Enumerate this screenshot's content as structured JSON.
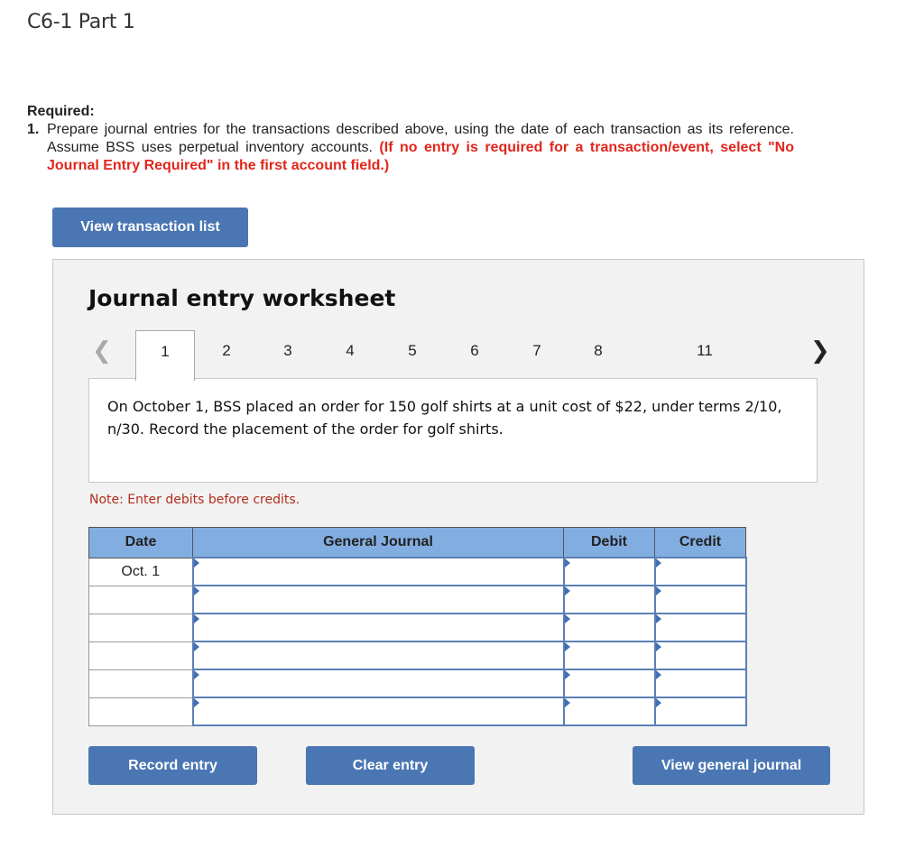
{
  "page": {
    "title": "C6-1 Part 1"
  },
  "required": {
    "label": "Required:",
    "item_number": "1.",
    "text": "Prepare journal entries for the transactions described above, using the date of each transaction as its reference. Assume BSS uses perpetual inventory accounts. ",
    "instruction": "(If no entry is required for a transaction/event, select \"No Journal Entry Required\" in the first account field.)"
  },
  "buttons": {
    "view_transaction_list": "View transaction list",
    "record_entry": "Record entry",
    "clear_entry": "Clear entry",
    "view_general_journal": "View general journal"
  },
  "worksheet": {
    "title": "Journal entry worksheet",
    "tabs": [
      {
        "label": "1",
        "active": true
      },
      {
        "label": "2",
        "active": false
      },
      {
        "label": "3",
        "active": false
      },
      {
        "label": "4",
        "active": false
      },
      {
        "label": "5",
        "active": false
      },
      {
        "label": "6",
        "active": false
      },
      {
        "label": "7",
        "active": false
      },
      {
        "label": "8",
        "active": false
      },
      {
        "label": "11",
        "active": false
      }
    ],
    "prev_icon": "chevron-left-icon",
    "next_icon": "chevron-right-icon",
    "question": "On October 1, BSS placed an order for 150 golf shirts at a unit cost of $22, under terms 2/10, n/30. Record the placement of the order for golf shirts.",
    "note": "Note: Enter debits before credits."
  },
  "journal": {
    "headers": {
      "date": "Date",
      "general_journal": "General Journal",
      "debit": "Debit",
      "credit": "Credit"
    },
    "rows": [
      {
        "date": "Oct. 1",
        "account": "",
        "debit": "",
        "credit": ""
      },
      {
        "date": "",
        "account": "",
        "debit": "",
        "credit": ""
      },
      {
        "date": "",
        "account": "",
        "debit": "",
        "credit": ""
      },
      {
        "date": "",
        "account": "",
        "debit": "",
        "credit": ""
      },
      {
        "date": "",
        "account": "",
        "debit": "",
        "credit": ""
      },
      {
        "date": "",
        "account": "",
        "debit": "",
        "credit": ""
      }
    ]
  },
  "colors": {
    "button_bg": "#4a76b3",
    "header_bg": "#82ade0",
    "instruction_red": "#e1261c",
    "note_red": "#b32d1e",
    "panel_bg": "#f2f2f2"
  }
}
